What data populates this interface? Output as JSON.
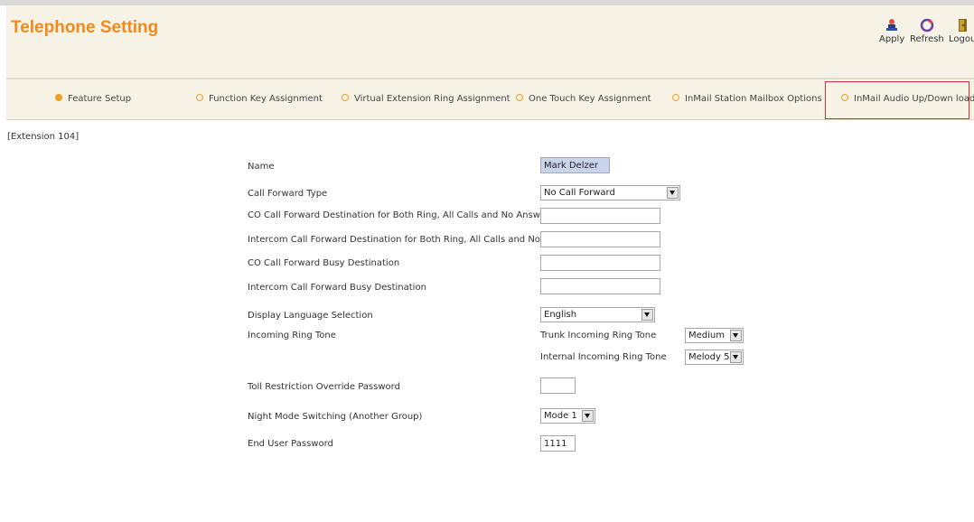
{
  "header": {
    "title": "Telephone Setting",
    "apply_label": "Apply",
    "refresh_label": "Refresh",
    "logout_label": "Logou"
  },
  "tabs": [
    {
      "label": "Feature Setup",
      "active": true
    },
    {
      "label": "Function Key Assignment",
      "active": false
    },
    {
      "label": "Virtual Extension Ring Assignment",
      "active": false
    },
    {
      "label": "One Touch Key Assignment",
      "active": false
    },
    {
      "label": "InMail Station Mailbox Options",
      "active": false
    },
    {
      "label": "InMail Audio Up/Down load",
      "active": false
    }
  ],
  "extension_label": "[Extension 104]",
  "form": {
    "name": {
      "label": "Name",
      "value": "Mark Delzer"
    },
    "call_forward_type": {
      "label": "Call Forward Type",
      "value": "No Call Forward"
    },
    "co_cf_dest": {
      "label": "CO Call Forward Destination for Both Ring, All Calls and No Answer",
      "value": ""
    },
    "ic_cf_dest": {
      "label": "Intercom Call Forward Destination for Both Ring, All Calls and No Answer",
      "value": ""
    },
    "co_cf_busy": {
      "label": "CO Call Forward Busy Destination",
      "value": ""
    },
    "ic_cf_busy": {
      "label": "Intercom Call Forward Busy Destination",
      "value": ""
    },
    "display_language": {
      "label": "Display Language Selection",
      "value": "English"
    },
    "incoming_ring_tone": {
      "label": "Incoming Ring Tone",
      "trunk_label": "Trunk Incoming Ring Tone",
      "trunk_value": "Medium",
      "internal_label": "Internal Incoming Ring Tone",
      "internal_value": "Melody 5"
    },
    "toll_password": {
      "label": "Toll Restriction Override Password",
      "value": ""
    },
    "night_mode": {
      "label": "Night Mode Switching (Another Group)",
      "value": "Mode 1"
    },
    "end_user_password": {
      "label": "End User Password",
      "value": "1111"
    }
  },
  "colors": {
    "title": "#f08a1a",
    "tab_bar": "#f6f2e6",
    "tab_dot": "#f0a020",
    "highlight_box": "#cc3333"
  }
}
